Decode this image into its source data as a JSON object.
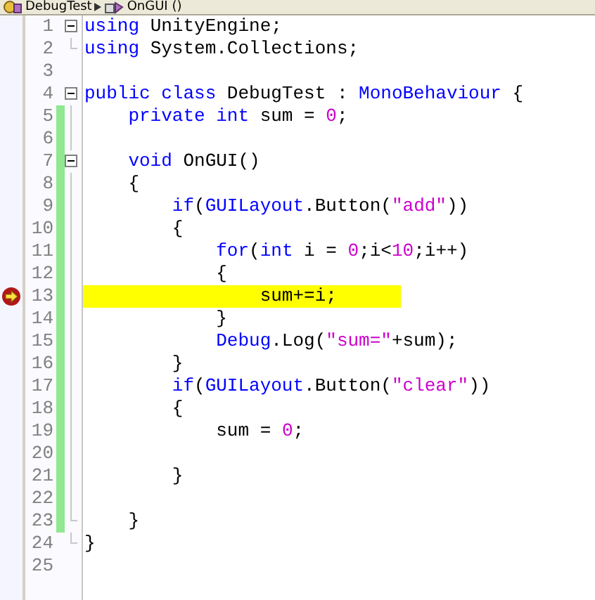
{
  "breadcrumb": [
    {
      "text": "DebugTest"
    },
    {
      "text": "OnGUI ()"
    }
  ],
  "lines": [
    {
      "number": "1",
      "collapsible": true,
      "block_end": false,
      "changed": false,
      "current": false,
      "highlighted": false,
      "tokens": [
        {
          "kind": "keyword",
          "text": "using"
        },
        {
          "kind": "plain",
          "text": " UnityEngine;"
        }
      ]
    },
    {
      "number": "2",
      "collapsible": false,
      "block_end": true,
      "changed": false,
      "current": false,
      "highlighted": false,
      "tokens": [
        {
          "kind": "keyword",
          "text": "using"
        },
        {
          "kind": "plain",
          "text": " System.Collections;"
        }
      ]
    },
    {
      "number": "3",
      "collapsible": false,
      "block_end": false,
      "changed": false,
      "current": false,
      "highlighted": false
    },
    {
      "number": "4",
      "collapsible": true,
      "block_end": false,
      "changed": false,
      "current": false,
      "highlighted": false,
      "tokens": [
        {
          "kind": "keyword",
          "text": "public class"
        },
        {
          "kind": "plain",
          "text": " DebugTest : "
        },
        {
          "kind": "keyword",
          "text": "MonoBehaviour"
        },
        {
          "kind": "plain",
          "text": " {"
        }
      ]
    },
    {
      "number": "5",
      "collapsible": false,
      "block_end": false,
      "changed": true,
      "current": false,
      "highlighted": false,
      "tokens": [
        {
          "kind": "keyword",
          "text": "    private int"
        },
        {
          "kind": "plain",
          "text": " sum = "
        },
        {
          "kind": "literal",
          "text": "0"
        },
        {
          "kind": "plain",
          "text": ";"
        }
      ]
    },
    {
      "number": "6",
      "collapsible": false,
      "block_end": false,
      "changed": true,
      "current": false,
      "highlighted": false
    },
    {
      "number": "7",
      "collapsible": true,
      "block_end": false,
      "changed": true,
      "current": false,
      "highlighted": false,
      "tokens": [
        {
          "kind": "keyword",
          "text": "    void"
        },
        {
          "kind": "plain",
          "text": " OnGUI()"
        }
      ]
    },
    {
      "number": "8",
      "collapsible": false,
      "block_end": false,
      "changed": true,
      "current": false,
      "highlighted": false,
      "tokens": [
        {
          "kind": "plain",
          "text": "    {"
        }
      ]
    },
    {
      "number": "9",
      "collapsible": false,
      "block_end": false,
      "changed": true,
      "current": false,
      "highlighted": false,
      "tokens": [
        {
          "kind": "keyword",
          "text": "        if"
        },
        {
          "kind": "plain",
          "text": "("
        },
        {
          "kind": "keyword",
          "text": "GUILayout"
        },
        {
          "kind": "plain",
          "text": ".Button("
        },
        {
          "kind": "literal",
          "text": "\"add\""
        },
        {
          "kind": "plain",
          "text": "))"
        }
      ]
    },
    {
      "number": "10",
      "collapsible": false,
      "block_end": false,
      "changed": true,
      "current": false,
      "highlighted": false,
      "tokens": [
        {
          "kind": "plain",
          "text": "        {"
        }
      ]
    },
    {
      "number": "11",
      "collapsible": false,
      "block_end": false,
      "changed": true,
      "current": false,
      "highlighted": false,
      "tokens": [
        {
          "kind": "keyword",
          "text": "            for"
        },
        {
          "kind": "plain",
          "text": "("
        },
        {
          "kind": "keyword",
          "text": "int"
        },
        {
          "kind": "plain",
          "text": " i = "
        },
        {
          "kind": "literal",
          "text": "0"
        },
        {
          "kind": "plain",
          "text": ";i<"
        },
        {
          "kind": "literal",
          "text": "10"
        },
        {
          "kind": "plain",
          "text": ";i++)"
        }
      ]
    },
    {
      "number": "12",
      "collapsible": false,
      "block_end": false,
      "changed": true,
      "current": false,
      "highlighted": false,
      "tokens": [
        {
          "kind": "plain",
          "text": "            {"
        }
      ]
    },
    {
      "number": "13",
      "collapsible": false,
      "block_end": false,
      "changed": true,
      "current": true,
      "highlighted": true,
      "tokens": [
        {
          "kind": "plain",
          "text": "                sum+=i;"
        }
      ]
    },
    {
      "number": "14",
      "collapsible": false,
      "block_end": false,
      "changed": true,
      "current": false,
      "highlighted": false,
      "tokens": [
        {
          "kind": "plain",
          "text": "            }"
        }
      ]
    },
    {
      "number": "15",
      "collapsible": false,
      "block_end": false,
      "changed": true,
      "current": false,
      "highlighted": false,
      "tokens": [
        {
          "kind": "keyword",
          "text": "            Debug"
        },
        {
          "kind": "plain",
          "text": ".Log("
        },
        {
          "kind": "literal",
          "text": "\"sum=\""
        },
        {
          "kind": "plain",
          "text": "+sum);"
        }
      ]
    },
    {
      "number": "16",
      "collapsible": false,
      "block_end": false,
      "changed": true,
      "current": false,
      "highlighted": false,
      "tokens": [
        {
          "kind": "plain",
          "text": "        }"
        }
      ]
    },
    {
      "number": "17",
      "collapsible": false,
      "block_end": false,
      "changed": true,
      "current": false,
      "highlighted": false,
      "tokens": [
        {
          "kind": "keyword",
          "text": "        if"
        },
        {
          "kind": "plain",
          "text": "("
        },
        {
          "kind": "keyword",
          "text": "GUILayout"
        },
        {
          "kind": "plain",
          "text": ".Button("
        },
        {
          "kind": "literal",
          "text": "\"clear\""
        },
        {
          "kind": "plain",
          "text": "))"
        }
      ]
    },
    {
      "number": "18",
      "collapsible": false,
      "block_end": false,
      "changed": true,
      "current": false,
      "highlighted": false,
      "tokens": [
        {
          "kind": "plain",
          "text": "        {"
        }
      ]
    },
    {
      "number": "19",
      "collapsible": false,
      "block_end": false,
      "changed": true,
      "current": false,
      "highlighted": false,
      "tokens": [
        {
          "kind": "plain",
          "text": "            sum = "
        },
        {
          "kind": "literal",
          "text": "0"
        },
        {
          "kind": "plain",
          "text": ";"
        }
      ]
    },
    {
      "number": "20",
      "collapsible": false,
      "block_end": false,
      "changed": true,
      "current": false,
      "highlighted": false
    },
    {
      "number": "21",
      "collapsible": false,
      "block_end": false,
      "changed": true,
      "current": false,
      "highlighted": false,
      "tokens": [
        {
          "kind": "plain",
          "text": "        }"
        }
      ]
    },
    {
      "number": "22",
      "collapsible": false,
      "block_end": false,
      "changed": true,
      "current": false,
      "highlighted": false
    },
    {
      "number": "23",
      "collapsible": false,
      "block_end": true,
      "changed": true,
      "current": false,
      "highlighted": false,
      "tokens": [
        {
          "kind": "plain",
          "text": "    }"
        }
      ]
    },
    {
      "number": "24",
      "collapsible": false,
      "block_end": true,
      "changed": false,
      "current": false,
      "highlighted": false,
      "tokens": [
        {
          "kind": "plain",
          "text": "}"
        }
      ]
    },
    {
      "number": "25",
      "collapsible": false,
      "block_end": false,
      "changed": false,
      "current": false,
      "highlighted": false
    }
  ]
}
